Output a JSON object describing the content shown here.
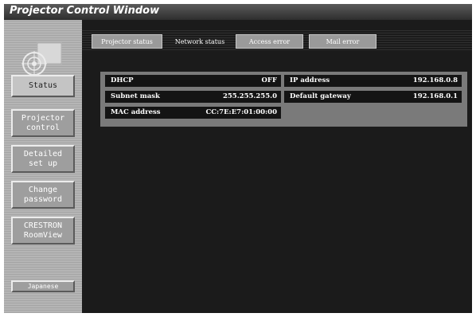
{
  "window": {
    "title": "Projector Control Window"
  },
  "sidebar": {
    "logo_icon": "globe-camera-icon",
    "items": [
      {
        "label": "Status"
      },
      {
        "label": "Projector\ncontrol"
      },
      {
        "label": "Detailed\nset up"
      },
      {
        "label": "Change\npassword"
      },
      {
        "label": "CRESTRON\nRoomView"
      }
    ],
    "language_button": "Japanese"
  },
  "tabs": [
    {
      "label": "Projector status",
      "active": false
    },
    {
      "label": "Network status",
      "active": true
    },
    {
      "label": "Access error",
      "active": false
    },
    {
      "label": "Mail error",
      "active": false
    }
  ],
  "network_status": {
    "dhcp": {
      "label": "DHCP",
      "value": "OFF"
    },
    "ip_address": {
      "label": "IP address",
      "value": "192.168.0.8"
    },
    "subnet_mask": {
      "label": "Subnet mask",
      "value": "255.255.255.0"
    },
    "default_gateway": {
      "label": "Default gateway",
      "value": "192.168.0.1"
    },
    "mac_address": {
      "label": "MAC address",
      "value": "CC:7E:E7:01:00:00"
    }
  }
}
